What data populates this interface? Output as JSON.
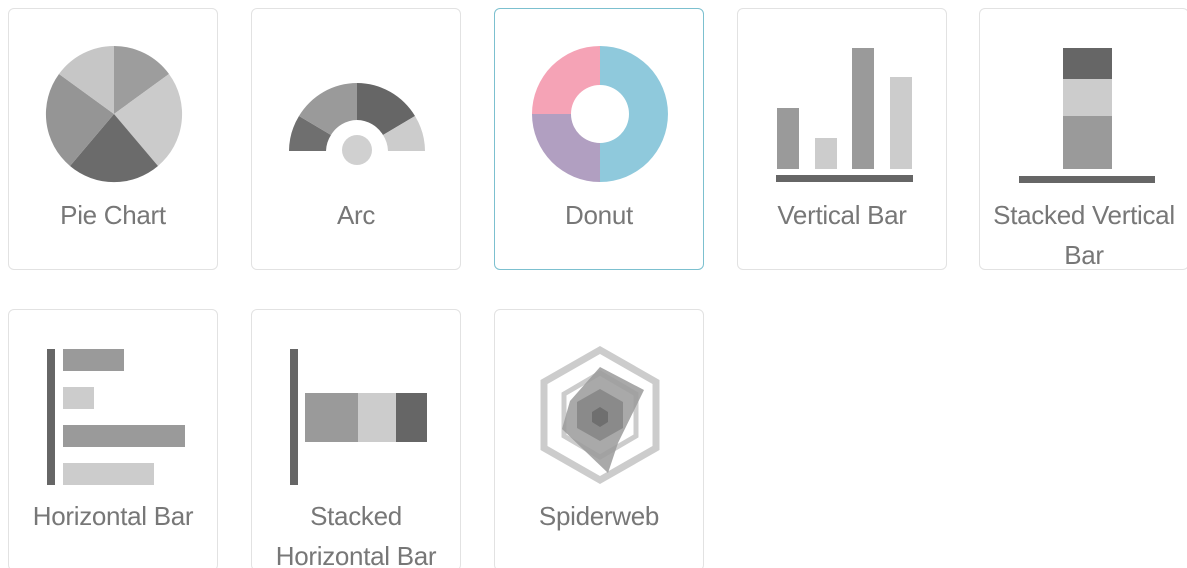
{
  "chart_types": [
    {
      "label": "Pie Chart",
      "icon": "pie-chart-icon",
      "selected": false
    },
    {
      "label": "Arc",
      "icon": "arc-chart-icon",
      "selected": false
    },
    {
      "label": "Donut",
      "icon": "donut-chart-icon",
      "selected": true
    },
    {
      "label": "Vertical Bar",
      "icon": "vertical-bar-chart-icon",
      "selected": false
    },
    {
      "label": "Stacked Vertical\nBar",
      "icon": "stacked-vertical-bar-chart-icon",
      "selected": false
    },
    {
      "label": "Horizontal Bar",
      "icon": "horizontal-bar-chart-icon",
      "selected": false
    },
    {
      "label": "Stacked\nHorizontal Bar",
      "icon": "stacked-horizontal-bar-chart-icon",
      "selected": false
    },
    {
      "label": "Spiderweb",
      "icon": "spiderweb-chart-icon",
      "selected": false
    }
  ],
  "colors": {
    "selected_border": "#7cc0cf",
    "card_border": "#e2e2e2",
    "label_text": "#777777",
    "donut_blue": "#8fc9dc",
    "donut_pink": "#f5a3b6",
    "donut_purple": "#b19fc1"
  }
}
